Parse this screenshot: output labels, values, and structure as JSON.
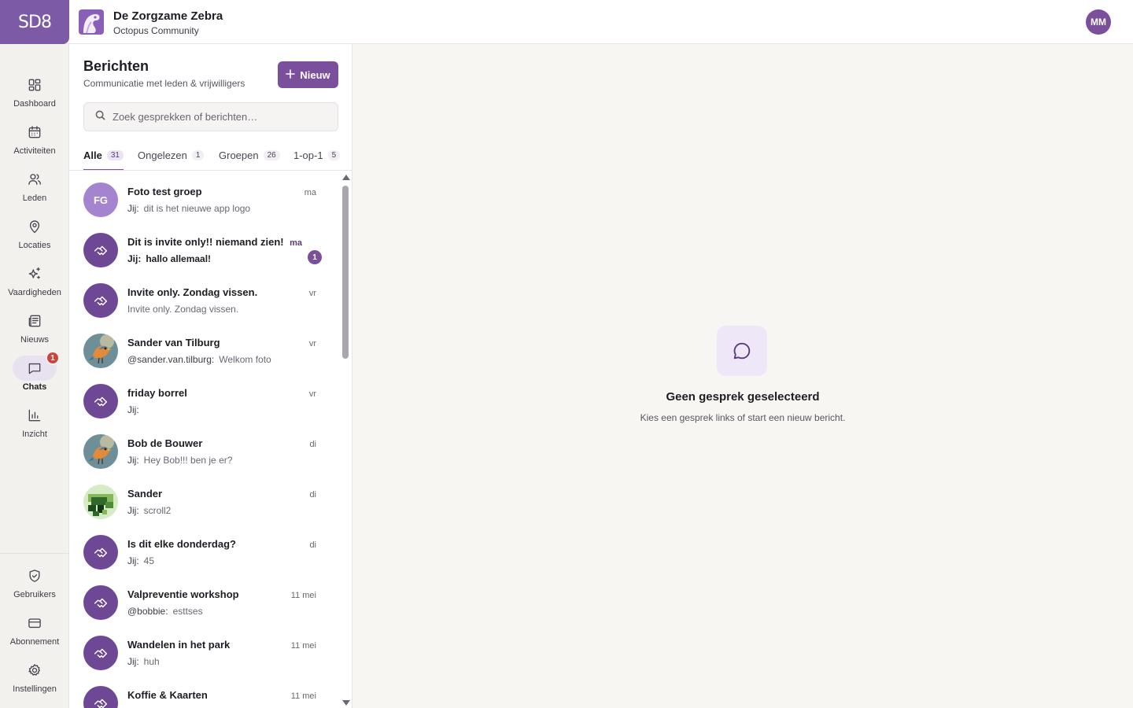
{
  "brand": {
    "logo_text": "SD8",
    "accent": "#7a4f9c"
  },
  "org": {
    "name": "De Zorgzame Zebra",
    "subtitle": "Octopus Community"
  },
  "user": {
    "initials": "MM"
  },
  "nav": {
    "items": [
      {
        "label": "Dashboard",
        "icon": "dashboard-icon"
      },
      {
        "label": "Activiteiten",
        "icon": "calendar-icon"
      },
      {
        "label": "Leden",
        "icon": "users-icon"
      },
      {
        "label": "Locaties",
        "icon": "map-pin-icon"
      },
      {
        "label": "Vaardigheden",
        "icon": "sparkles-icon"
      },
      {
        "label": "Nieuws",
        "icon": "newspaper-icon"
      },
      {
        "label": "Chats",
        "icon": "chat-icon",
        "badge": "1",
        "active": true
      },
      {
        "label": "Inzicht",
        "icon": "bar-chart-icon"
      }
    ],
    "bottom": [
      {
        "label": "Gebruikers",
        "icon": "shield-check-icon"
      },
      {
        "label": "Abonnement",
        "icon": "credit-card-icon"
      },
      {
        "label": "Instellingen",
        "icon": "gear-icon"
      }
    ]
  },
  "messages": {
    "title": "Berichten",
    "subtitle": "Communicatie met leden & vrijwilligers",
    "new_button": "Nieuw",
    "search_placeholder": "Zoek gesprekken of berichten…",
    "tabs": [
      {
        "label": "Alle",
        "count": "31",
        "active": true
      },
      {
        "label": "Ongelezen",
        "count": "1"
      },
      {
        "label": "Groepen",
        "count": "26"
      },
      {
        "label": "1-op-1",
        "count": "5"
      }
    ],
    "conversations": [
      {
        "name": "Foto test groep",
        "time": "ma",
        "sender": "Jij:",
        "preview": "dit is het nieuwe app logo",
        "avatar": "initials",
        "initials": "FG"
      },
      {
        "name": "Dit is invite only!! niemand zien!",
        "time": "ma",
        "sender": "Jij:",
        "preview": "hallo allemaal!",
        "avatar": "group",
        "unread": "1"
      },
      {
        "name": "Invite only. Zondag vissen.",
        "time": "vr",
        "sender": "",
        "preview": "Invite only. Zondag vissen.",
        "avatar": "group"
      },
      {
        "name": "Sander van Tilburg",
        "time": "vr",
        "sender": "@sander.van.tilburg:",
        "preview": "Welkom foto",
        "avatar": "bird"
      },
      {
        "name": "friday borrel",
        "time": "vr",
        "sender": "Jij:",
        "preview": "",
        "avatar": "group"
      },
      {
        "name": "Bob de Bouwer",
        "time": "di",
        "sender": "Jij:",
        "preview": "Hey Bob!!! ben je er?",
        "avatar": "bird"
      },
      {
        "name": "Sander",
        "time": "di",
        "sender": "Jij:",
        "preview": "scroll2",
        "avatar": "pixel"
      },
      {
        "name": "Is dit elke donderdag?",
        "time": "di",
        "sender": "Jij:",
        "preview": "45",
        "avatar": "group"
      },
      {
        "name": "Valpreventie workshop",
        "time": "11 mei",
        "sender": "@bobbie:",
        "preview": "esttses",
        "avatar": "group"
      },
      {
        "name": "Wandelen in het park",
        "time": "11 mei",
        "sender": "Jij:",
        "preview": "huh",
        "avatar": "group"
      },
      {
        "name": "Koffie & Kaarten",
        "time": "11 mei",
        "sender": "",
        "preview": "",
        "avatar": "group"
      }
    ]
  },
  "empty_state": {
    "title": "Geen gesprek geselecteerd",
    "subtitle": "Kies een gesprek links of start een nieuw bericht.",
    "icon": "chat-bubble-icon"
  }
}
